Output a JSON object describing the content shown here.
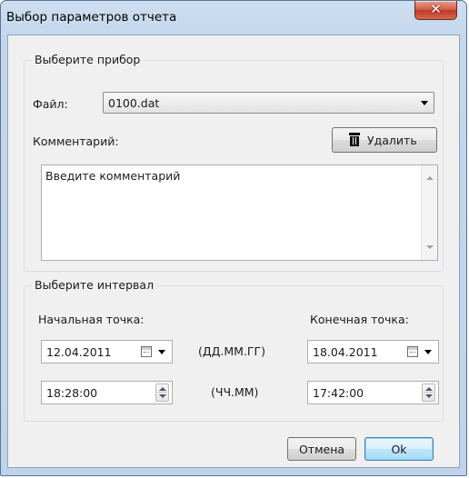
{
  "window": {
    "title": "Выбор параметров отчета",
    "close_symbol": "✕"
  },
  "device_group": {
    "legend": "Выберите прибор",
    "file_label": "Файл:",
    "file_value": "0100.dat",
    "comment_label": "Комментарий:",
    "delete_button": "Удалить",
    "comment_text": "Введите комментарий"
  },
  "interval_group": {
    "legend": "Выберите интервал",
    "start_label": "Начальная точка:",
    "end_label": "Конечная точка:",
    "start_date": "12.04.2011",
    "end_date": "18.04.2011",
    "date_format": "(ДД.ММ.ГГ)",
    "start_time": "18:28:00",
    "end_time": "17:42:00",
    "time_format": "(ЧЧ.ММ)"
  },
  "buttons": {
    "cancel": "Отмена",
    "ok": "Ok"
  }
}
